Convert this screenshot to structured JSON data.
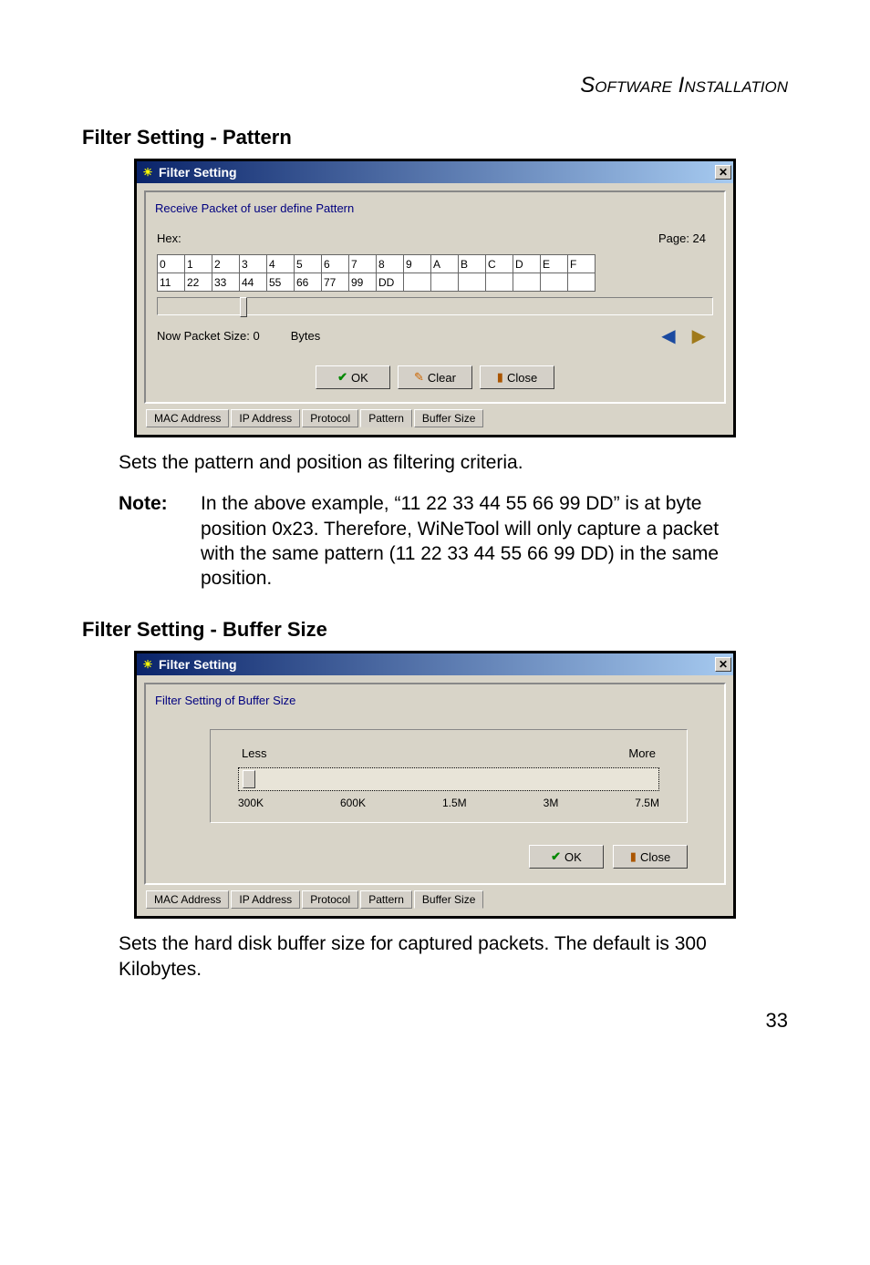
{
  "page_heading": "Software Installation",
  "page_number": "33",
  "section1_title": "Filter Setting - Pattern",
  "section2_title": "Filter Setting - Buffer Size",
  "dialog_pattern": {
    "title": "Filter Setting",
    "group_label": "Receive Packet of user define Pattern",
    "hex_label": "Hex:",
    "page_label": "Page: 24",
    "hex_headers": [
      "0",
      "1",
      "2",
      "3",
      "4",
      "5",
      "6",
      "7",
      "8",
      "9",
      "A",
      "B",
      "C",
      "D",
      "E",
      "F"
    ],
    "hex_values": [
      "11",
      "22",
      "33",
      "44",
      "55",
      "66",
      "77",
      "99",
      "DD",
      "",
      "",
      "",
      "",
      "",
      "",
      ""
    ],
    "nowpkt_label": "Now Packet Size: 0",
    "bytes_label": "Bytes",
    "btn_ok": "OK",
    "btn_clear": "Clear",
    "btn_close": "Close",
    "tabs": [
      "MAC Address",
      "IP Address",
      "Protocol",
      "Pattern",
      "Buffer Size"
    ],
    "active_tab_index": 3
  },
  "section1_desc": "Sets the pattern and position as filtering criteria.",
  "note_label": "Note:",
  "note_text": "In the above example, “11 22 33 44 55 66 99 DD” is at byte position 0x23. Therefore, WiNeTool will only capture a packet with the same pattern (11 22 33 44 55 66 99 DD) in the same position.",
  "dialog_buffer": {
    "title": "Filter Setting",
    "group_label": "Filter Setting of Buffer Size",
    "less_label": "Less",
    "more_label": "More",
    "ticks": [
      "300K",
      "600K",
      "1.5M",
      "3M",
      "7.5M"
    ],
    "btn_ok": "OK",
    "btn_close": "Close",
    "tabs": [
      "MAC Address",
      "IP Address",
      "Protocol",
      "Pattern",
      "Buffer Size"
    ],
    "active_tab_index": 4
  },
  "section2_desc": "Sets the hard disk buffer size for captured packets. The default is 300 Kilobytes."
}
